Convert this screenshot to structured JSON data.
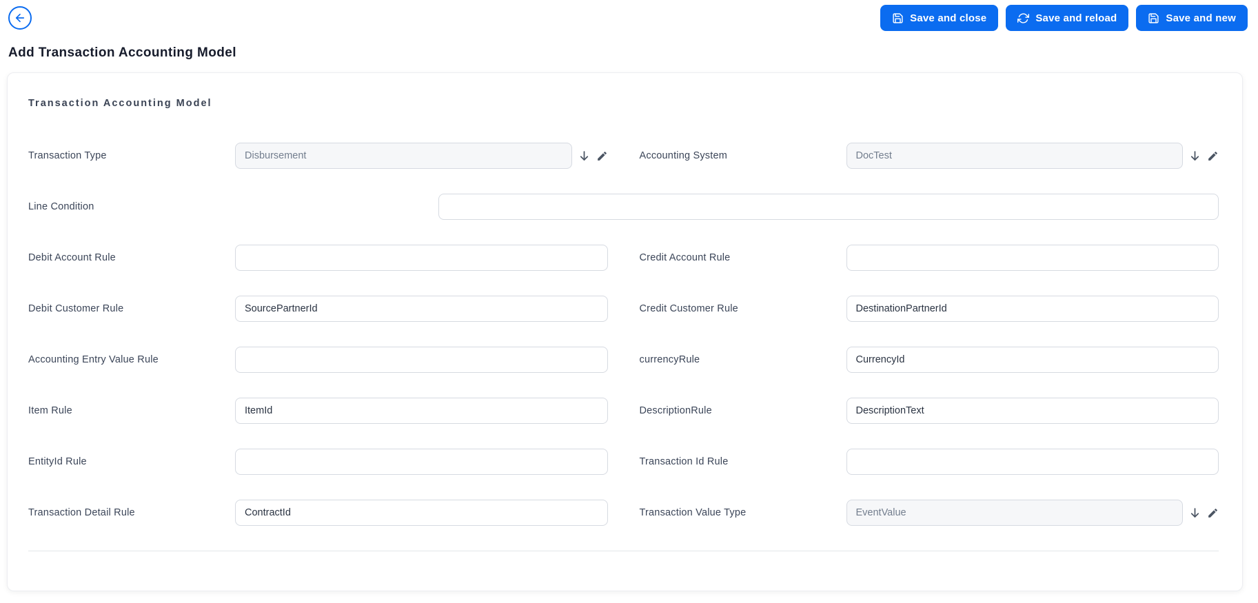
{
  "colors": {
    "primary": "#0b6cf0",
    "label_text": "#3b4558",
    "value_text": "#2a3342",
    "disabled_text": "#737e8e",
    "disabled_bg": "#f6f7f9",
    "input_border": "#d6dae1"
  },
  "header": {
    "buttons": [
      {
        "label": "Save and close",
        "icon": "save-icon"
      },
      {
        "label": "Save and reload",
        "icon": "reload-icon"
      },
      {
        "label": "Save and new",
        "icon": "save-icon"
      }
    ],
    "back_icon": "arrow-left-icon"
  },
  "page": {
    "title": "Add Transaction Accounting Model"
  },
  "card": {
    "section_title": "Transaction Accounting Model",
    "dropdown_icons": [
      "arrow-down-icon",
      "edit-pencil-icon"
    ],
    "fields": {
      "transaction_type": {
        "label": "Transaction Type",
        "value": "Disbursement",
        "kind": "dropdown"
      },
      "accounting_system": {
        "label": "Accounting System",
        "value": "DocTest",
        "kind": "dropdown"
      },
      "line_condition": {
        "label": "Line Condition",
        "value": "",
        "kind": "text-full"
      },
      "debit_account_rule": {
        "label": "Debit Account Rule",
        "value": "",
        "kind": "text"
      },
      "credit_account_rule": {
        "label": "Credit Account Rule",
        "value": "",
        "kind": "text"
      },
      "debit_customer_rule": {
        "label": "Debit Customer Rule",
        "value": "SourcePartnerId",
        "kind": "text"
      },
      "credit_customer_rule": {
        "label": "Credit Customer Rule",
        "value": "DestinationPartnerId",
        "kind": "text"
      },
      "accounting_entry_value_rule": {
        "label": "Accounting Entry Value Rule",
        "value": "",
        "kind": "text"
      },
      "currency_rule": {
        "label": "currencyRule",
        "value": "CurrencyId",
        "kind": "text"
      },
      "item_rule": {
        "label": "Item Rule",
        "value": "ItemId",
        "kind": "text"
      },
      "description_rule": {
        "label": "DescriptionRule",
        "value": "DescriptionText",
        "kind": "text"
      },
      "entityid_rule": {
        "label": "EntityId Rule",
        "value": "",
        "kind": "text"
      },
      "transaction_id_rule": {
        "label": "Transaction Id Rule",
        "value": "",
        "kind": "text"
      },
      "transaction_detail_rule": {
        "label": "Transaction Detail Rule",
        "value": "ContractId",
        "kind": "text"
      },
      "transaction_value_type": {
        "label": "Transaction Value Type",
        "value": "EventValue",
        "kind": "dropdown"
      }
    }
  }
}
